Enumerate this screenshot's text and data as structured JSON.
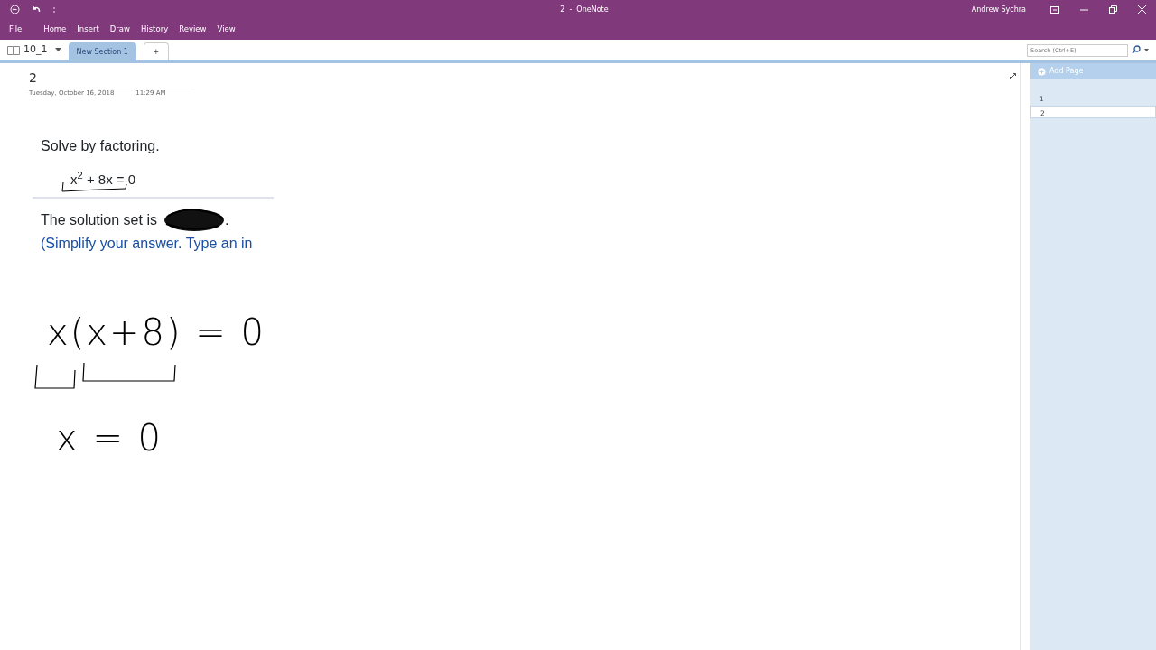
{
  "window": {
    "title": "2  -  OneNote",
    "user": "Andrew Sychra"
  },
  "ribbon_tabs": [
    {
      "label": "File"
    },
    {
      "label": "Home"
    },
    {
      "label": "Insert"
    },
    {
      "label": "Draw"
    },
    {
      "label": "History"
    },
    {
      "label": "Review"
    },
    {
      "label": "View"
    }
  ],
  "notebook": {
    "name": "10_1"
  },
  "sections": [
    {
      "label": "New Section 1",
      "selected": true
    },
    {
      "label": "+",
      "selected": false
    }
  ],
  "search": {
    "placeholder": "Search (Ctrl+E)"
  },
  "page": {
    "title": "2",
    "date": "Tuesday, October 16, 2018",
    "time": "11:29 AM",
    "problem": {
      "heading": "Solve by factoring.",
      "equation": "x$^{2}$ + 8x = 0",
      "answer_prefix": "The solution set is",
      "answer_suffix": ".",
      "hint": "(Simplify your answer. Type an in"
    },
    "ink": [
      {
        "text": "x(x+8) = 0"
      },
      {
        "text": "x = 0"
      }
    ]
  },
  "pages_pane": {
    "add_label": "Add Page",
    "pages": [
      {
        "label": "1",
        "selected": false
      },
      {
        "label": "2",
        "selected": true
      }
    ]
  }
}
